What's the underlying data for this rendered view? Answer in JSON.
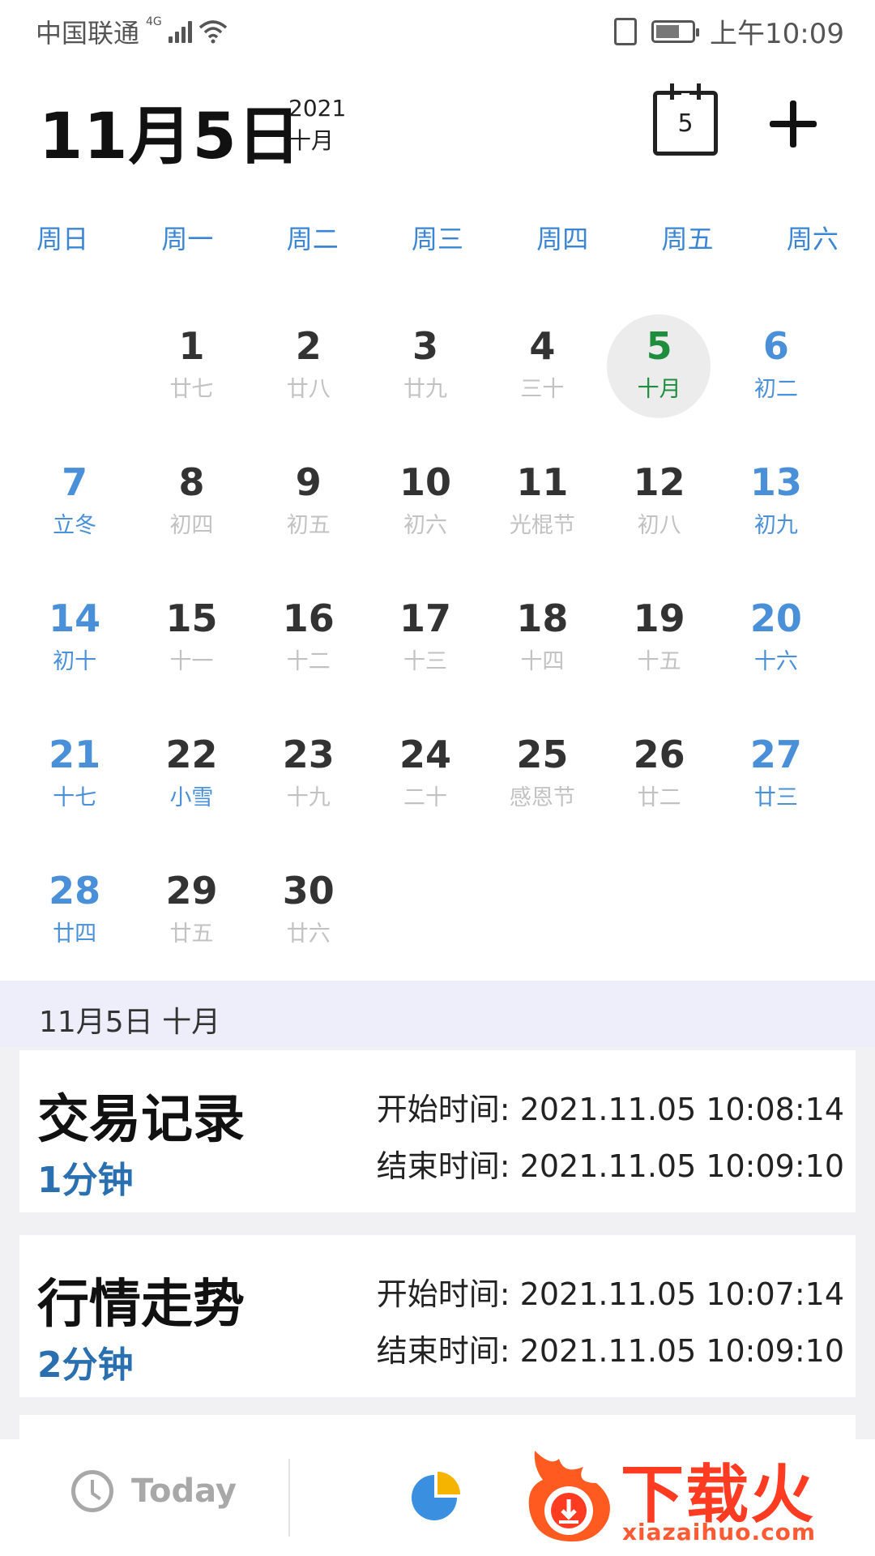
{
  "status_bar": {
    "carrier": "中国联通",
    "network": "4G",
    "time": "上午10:09"
  },
  "header": {
    "date": "11月5日",
    "year": "2021",
    "lunar_month": "十月",
    "calendar_badge": "5"
  },
  "weekdays": [
    "周日",
    "周一",
    "周二",
    "周三",
    "周四",
    "周五",
    "周六"
  ],
  "calendar": {
    "selected_day": "5",
    "days": [
      {
        "num": "",
        "lunar": ""
      },
      {
        "num": "1",
        "lunar": "廿七"
      },
      {
        "num": "2",
        "lunar": "廿八"
      },
      {
        "num": "3",
        "lunar": "廿九"
      },
      {
        "num": "4",
        "lunar": "三十"
      },
      {
        "num": "5",
        "lunar": "十月"
      },
      {
        "num": "6",
        "lunar": "初二"
      },
      {
        "num": "7",
        "lunar": "立冬"
      },
      {
        "num": "8",
        "lunar": "初四"
      },
      {
        "num": "9",
        "lunar": "初五"
      },
      {
        "num": "10",
        "lunar": "初六"
      },
      {
        "num": "11",
        "lunar": "光棍节"
      },
      {
        "num": "12",
        "lunar": "初八"
      },
      {
        "num": "13",
        "lunar": "初九"
      },
      {
        "num": "14",
        "lunar": "初十"
      },
      {
        "num": "15",
        "lunar": "十一"
      },
      {
        "num": "16",
        "lunar": "十二"
      },
      {
        "num": "17",
        "lunar": "十三"
      },
      {
        "num": "18",
        "lunar": "十四"
      },
      {
        "num": "19",
        "lunar": "十五"
      },
      {
        "num": "20",
        "lunar": "十六"
      },
      {
        "num": "21",
        "lunar": "十七"
      },
      {
        "num": "22",
        "lunar": "小雪"
      },
      {
        "num": "23",
        "lunar": "十九"
      },
      {
        "num": "24",
        "lunar": "二十"
      },
      {
        "num": "25",
        "lunar": "感恩节"
      },
      {
        "num": "26",
        "lunar": "廿二"
      },
      {
        "num": "27",
        "lunar": "廿三"
      },
      {
        "num": "28",
        "lunar": "廿四"
      },
      {
        "num": "29",
        "lunar": "廿五"
      },
      {
        "num": "30",
        "lunar": "廿六"
      }
    ],
    "solar_terms": [
      "7",
      "22"
    ]
  },
  "selected_date_label": "11月5日 十月",
  "events": [
    {
      "title": "交易记录",
      "duration": "1分钟",
      "start": "开始时间: 2021.11.05 10:08:14",
      "end": "结束时间: 2021.11.05 10:09:10"
    },
    {
      "title": "行情走势",
      "duration": "2分钟",
      "start": "开始时间: 2021.11.05 10:07:14",
      "end": "结束时间: 2021.11.05 10:09:10"
    }
  ],
  "bottom_bar": {
    "today_label": "Today"
  },
  "watermark": {
    "text": "下载火",
    "sub": "xiazaihuo.com"
  },
  "colors": {
    "weekend": "#4a90d9",
    "selected": "#1e8e3e",
    "duration": "#2a6fb0",
    "date_bar": "#eeeefb"
  }
}
